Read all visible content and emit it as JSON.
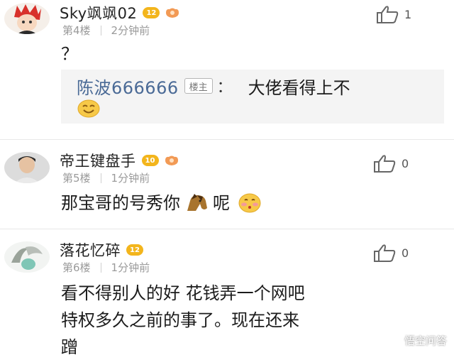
{
  "comments": [
    {
      "username": "Sky飒飒02",
      "level": "12",
      "floor": "第4楼",
      "time": "2分钟前",
      "likes": "1",
      "text": "？",
      "quote": {
        "author": "陈波666666",
        "author_badge": "楼主",
        "colon": "：",
        "text": "大佬看得上不"
      }
    },
    {
      "username": "帝王键盘手",
      "level": "10",
      "floor": "第5楼",
      "time": "1分钟前",
      "likes": "0",
      "text": "那宝哥的号秀你",
      "text_after": "呢"
    },
    {
      "username": "落花忆碎",
      "level": "12",
      "floor": "第6楼",
      "time": "1分钟前",
      "likes": "0",
      "text_line1": "看不得别人的好 花钱弄一个网吧",
      "text_line2": "特权多久之前的事了。现在还来",
      "text_line3": "蹭"
    }
  ],
  "watermark": "悟空问答",
  "colors": {
    "level_badge": "#f3b51c",
    "quote_name": "#4a6a96",
    "meta_gray": "#9a9a9a",
    "quote_bg": "#f4f4f4"
  }
}
